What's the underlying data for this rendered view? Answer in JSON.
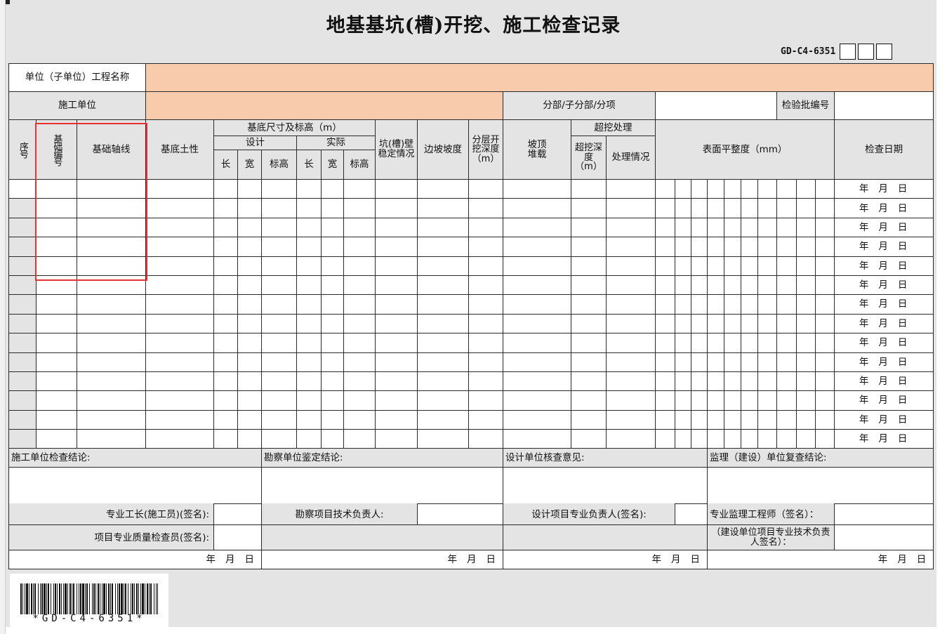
{
  "title": "地基基坑(槽)开挖、施工检查记录",
  "form_code": "GD-C4-6351",
  "header": {
    "project_name_label": "单位（子单位）工程名称",
    "contractor_label": "施工单位",
    "subdivision_label": "分部/子分部/分项",
    "batch_no_label": "检验批编号"
  },
  "columns": {
    "seq": "序号",
    "foundation_no": "基础编号",
    "axis": "基础轴线",
    "soil": "基底土性",
    "dimensions": "基底尺寸及标高（m）",
    "design": "设计",
    "actual": "实际",
    "length": "长",
    "width": "宽",
    "elevation": "标高",
    "pit_wall": "坑(槽)壁稳定情况",
    "slope": "边坡坡度",
    "layered_depth": "分层开挖深度（m）",
    "slope_top_load": "坡顶堆载",
    "overexcavation": "超挖处理",
    "over_depth": "超挖深度（m）",
    "treatment": "处理情况",
    "flatness": "表面平整度（mm）",
    "check_date": "检查日期"
  },
  "date_parts": {
    "year": "年",
    "month": "月",
    "day": "日"
  },
  "row_count": 14,
  "conclusions": {
    "construction": {
      "title": "施工单位检查结论:",
      "sign1": "专业工长(施工员)(签名):",
      "sign2": "项目专业质量检查员(签名):"
    },
    "survey": {
      "title": "勘察单位鉴定结论:",
      "sign1": "勘察项目技术负责人:"
    },
    "design": {
      "title": "设计单位核查意见:",
      "sign1": "设计项目专业负责人(签名):"
    },
    "supervision": {
      "title": "监理（建设）单位复查结论:",
      "sign1": "专业监理工程师（签名）：",
      "sign2": "（建设单位项目专业技术负责人签名）："
    }
  },
  "barcode_text": "*GD-C4-6351*",
  "colors": {
    "header_fill": "#f8cbad",
    "highlight": "#e53333",
    "sheet_bg": "#e4e4e4"
  }
}
